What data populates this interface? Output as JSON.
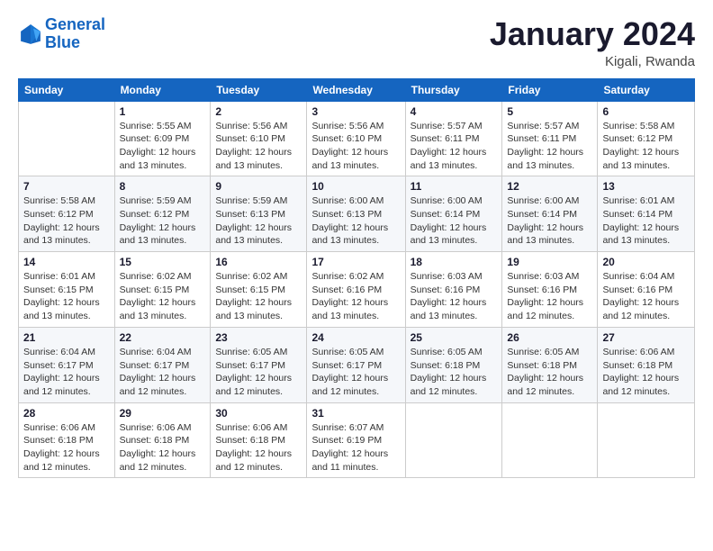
{
  "header": {
    "logo_line1": "General",
    "logo_line2": "Blue",
    "month_title": "January 2024",
    "location": "Kigali, Rwanda"
  },
  "days_of_week": [
    "Sunday",
    "Monday",
    "Tuesday",
    "Wednesday",
    "Thursday",
    "Friday",
    "Saturday"
  ],
  "weeks": [
    [
      {
        "num": "",
        "sunrise": "",
        "sunset": "",
        "daylight": ""
      },
      {
        "num": "1",
        "sunrise": "Sunrise: 5:55 AM",
        "sunset": "Sunset: 6:09 PM",
        "daylight": "Daylight: 12 hours and 13 minutes."
      },
      {
        "num": "2",
        "sunrise": "Sunrise: 5:56 AM",
        "sunset": "Sunset: 6:10 PM",
        "daylight": "Daylight: 12 hours and 13 minutes."
      },
      {
        "num": "3",
        "sunrise": "Sunrise: 5:56 AM",
        "sunset": "Sunset: 6:10 PM",
        "daylight": "Daylight: 12 hours and 13 minutes."
      },
      {
        "num": "4",
        "sunrise": "Sunrise: 5:57 AM",
        "sunset": "Sunset: 6:11 PM",
        "daylight": "Daylight: 12 hours and 13 minutes."
      },
      {
        "num": "5",
        "sunrise": "Sunrise: 5:57 AM",
        "sunset": "Sunset: 6:11 PM",
        "daylight": "Daylight: 12 hours and 13 minutes."
      },
      {
        "num": "6",
        "sunrise": "Sunrise: 5:58 AM",
        "sunset": "Sunset: 6:12 PM",
        "daylight": "Daylight: 12 hours and 13 minutes."
      }
    ],
    [
      {
        "num": "7",
        "sunrise": "Sunrise: 5:58 AM",
        "sunset": "Sunset: 6:12 PM",
        "daylight": "Daylight: 12 hours and 13 minutes."
      },
      {
        "num": "8",
        "sunrise": "Sunrise: 5:59 AM",
        "sunset": "Sunset: 6:12 PM",
        "daylight": "Daylight: 12 hours and 13 minutes."
      },
      {
        "num": "9",
        "sunrise": "Sunrise: 5:59 AM",
        "sunset": "Sunset: 6:13 PM",
        "daylight": "Daylight: 12 hours and 13 minutes."
      },
      {
        "num": "10",
        "sunrise": "Sunrise: 6:00 AM",
        "sunset": "Sunset: 6:13 PM",
        "daylight": "Daylight: 12 hours and 13 minutes."
      },
      {
        "num": "11",
        "sunrise": "Sunrise: 6:00 AM",
        "sunset": "Sunset: 6:14 PM",
        "daylight": "Daylight: 12 hours and 13 minutes."
      },
      {
        "num": "12",
        "sunrise": "Sunrise: 6:00 AM",
        "sunset": "Sunset: 6:14 PM",
        "daylight": "Daylight: 12 hours and 13 minutes."
      },
      {
        "num": "13",
        "sunrise": "Sunrise: 6:01 AM",
        "sunset": "Sunset: 6:14 PM",
        "daylight": "Daylight: 12 hours and 13 minutes."
      }
    ],
    [
      {
        "num": "14",
        "sunrise": "Sunrise: 6:01 AM",
        "sunset": "Sunset: 6:15 PM",
        "daylight": "Daylight: 12 hours and 13 minutes."
      },
      {
        "num": "15",
        "sunrise": "Sunrise: 6:02 AM",
        "sunset": "Sunset: 6:15 PM",
        "daylight": "Daylight: 12 hours and 13 minutes."
      },
      {
        "num": "16",
        "sunrise": "Sunrise: 6:02 AM",
        "sunset": "Sunset: 6:15 PM",
        "daylight": "Daylight: 12 hours and 13 minutes."
      },
      {
        "num": "17",
        "sunrise": "Sunrise: 6:02 AM",
        "sunset": "Sunset: 6:16 PM",
        "daylight": "Daylight: 12 hours and 13 minutes."
      },
      {
        "num": "18",
        "sunrise": "Sunrise: 6:03 AM",
        "sunset": "Sunset: 6:16 PM",
        "daylight": "Daylight: 12 hours and 13 minutes."
      },
      {
        "num": "19",
        "sunrise": "Sunrise: 6:03 AM",
        "sunset": "Sunset: 6:16 PM",
        "daylight": "Daylight: 12 hours and 12 minutes."
      },
      {
        "num": "20",
        "sunrise": "Sunrise: 6:04 AM",
        "sunset": "Sunset: 6:16 PM",
        "daylight": "Daylight: 12 hours and 12 minutes."
      }
    ],
    [
      {
        "num": "21",
        "sunrise": "Sunrise: 6:04 AM",
        "sunset": "Sunset: 6:17 PM",
        "daylight": "Daylight: 12 hours and 12 minutes."
      },
      {
        "num": "22",
        "sunrise": "Sunrise: 6:04 AM",
        "sunset": "Sunset: 6:17 PM",
        "daylight": "Daylight: 12 hours and 12 minutes."
      },
      {
        "num": "23",
        "sunrise": "Sunrise: 6:05 AM",
        "sunset": "Sunset: 6:17 PM",
        "daylight": "Daylight: 12 hours and 12 minutes."
      },
      {
        "num": "24",
        "sunrise": "Sunrise: 6:05 AM",
        "sunset": "Sunset: 6:17 PM",
        "daylight": "Daylight: 12 hours and 12 minutes."
      },
      {
        "num": "25",
        "sunrise": "Sunrise: 6:05 AM",
        "sunset": "Sunset: 6:18 PM",
        "daylight": "Daylight: 12 hours and 12 minutes."
      },
      {
        "num": "26",
        "sunrise": "Sunrise: 6:05 AM",
        "sunset": "Sunset: 6:18 PM",
        "daylight": "Daylight: 12 hours and 12 minutes."
      },
      {
        "num": "27",
        "sunrise": "Sunrise: 6:06 AM",
        "sunset": "Sunset: 6:18 PM",
        "daylight": "Daylight: 12 hours and 12 minutes."
      }
    ],
    [
      {
        "num": "28",
        "sunrise": "Sunrise: 6:06 AM",
        "sunset": "Sunset: 6:18 PM",
        "daylight": "Daylight: 12 hours and 12 minutes."
      },
      {
        "num": "29",
        "sunrise": "Sunrise: 6:06 AM",
        "sunset": "Sunset: 6:18 PM",
        "daylight": "Daylight: 12 hours and 12 minutes."
      },
      {
        "num": "30",
        "sunrise": "Sunrise: 6:06 AM",
        "sunset": "Sunset: 6:18 PM",
        "daylight": "Daylight: 12 hours and 12 minutes."
      },
      {
        "num": "31",
        "sunrise": "Sunrise: 6:07 AM",
        "sunset": "Sunset: 6:19 PM",
        "daylight": "Daylight: 12 hours and 11 minutes."
      },
      {
        "num": "",
        "sunrise": "",
        "sunset": "",
        "daylight": ""
      },
      {
        "num": "",
        "sunrise": "",
        "sunset": "",
        "daylight": ""
      },
      {
        "num": "",
        "sunrise": "",
        "sunset": "",
        "daylight": ""
      }
    ]
  ]
}
